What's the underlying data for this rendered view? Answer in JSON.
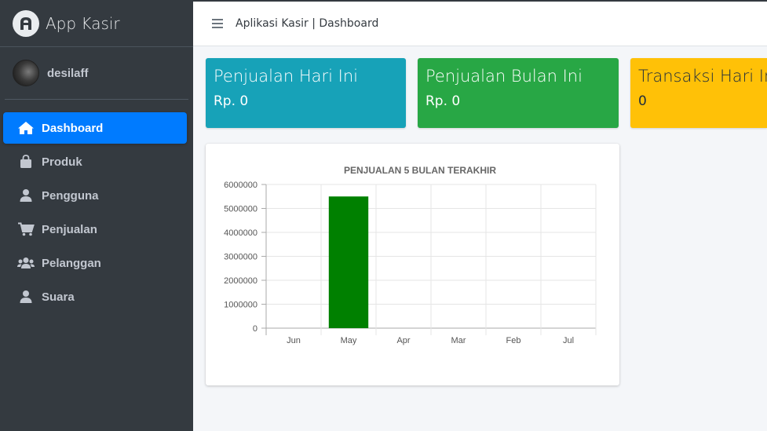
{
  "app": {
    "name": "App Kasir"
  },
  "user": {
    "name": "desilaff"
  },
  "sidebar": {
    "items": [
      {
        "label": "Dashboard",
        "icon": "home-icon",
        "active": true
      },
      {
        "label": "Produk",
        "icon": "shopping-bag-icon",
        "active": false
      },
      {
        "label": "Pengguna",
        "icon": "user-icon",
        "active": false
      },
      {
        "label": "Penjualan",
        "icon": "shopping-cart-icon",
        "active": false
      },
      {
        "label": "Pelanggan",
        "icon": "users-icon",
        "active": false
      },
      {
        "label": "Suara",
        "icon": "user-icon",
        "active": false
      }
    ]
  },
  "header": {
    "title": "Aplikasi Kasir | Dashboard"
  },
  "cards": [
    {
      "title": "Penjualan Hari Ini",
      "value": "Rp. 0",
      "color": "#17a2b8"
    },
    {
      "title": "Penjualan Bulan Ini",
      "value": "Rp. 0",
      "color": "#28a745"
    },
    {
      "title": "Transaksi Hari Ini",
      "value": "0",
      "color": "#ffc107"
    }
  ],
  "colors": {
    "sidebar": "#343a40",
    "active": "#007bff",
    "bar": "#008000"
  },
  "chart_data": {
    "type": "bar",
    "title": "PENJUALAN 5 BULAN TERAKHIR",
    "categories": [
      "Jun",
      "May",
      "Apr",
      "Mar",
      "Feb",
      "Jul"
    ],
    "values": [
      0,
      5500000,
      0,
      0,
      0,
      0
    ],
    "yticks": [
      "0",
      "1000000",
      "2000000",
      "3000000",
      "4000000",
      "5000000",
      "6000000"
    ],
    "ylim": [
      0,
      6000000
    ],
    "grid": true,
    "bar_color": "#008000"
  }
}
